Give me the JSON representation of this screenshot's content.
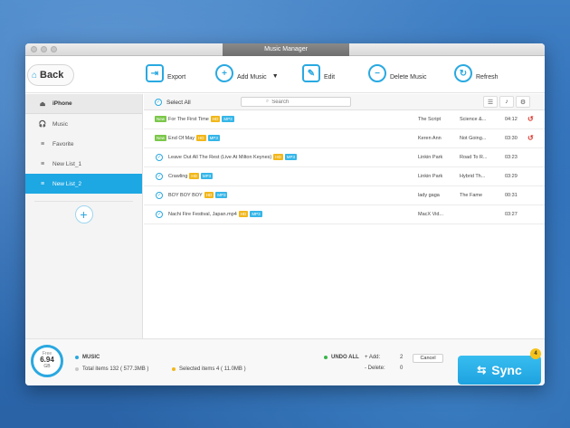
{
  "window": {
    "title": "Music Manager"
  },
  "toolbar": {
    "back_label": "Back",
    "export_label": "Export",
    "add_music_label": "Add Music",
    "edit_label": "Edit",
    "delete_label": "Delete Music",
    "refresh_label": "Refresh"
  },
  "sidebar": {
    "device": "iPhone",
    "items": [
      {
        "label": "Music",
        "icon": "headphones-icon"
      },
      {
        "label": "Favorite",
        "icon": "playlist-icon"
      },
      {
        "label": "New List_1",
        "icon": "playlist-icon"
      },
      {
        "label": "New List_2",
        "icon": "playlist-icon",
        "active": true
      }
    ]
  },
  "list": {
    "select_all_label": "Select All",
    "search_placeholder": "Search",
    "rows": [
      {
        "new": "New",
        "title": "For The First Time",
        "hd": "HD",
        "fmt": "MP3",
        "artist": "The Script",
        "album": "Science &...",
        "time": "04:12",
        "status": "pending"
      },
      {
        "new": "New",
        "title": "End Of May",
        "hd": "HD",
        "fmt": "MP3",
        "artist": "Keren Ann",
        "album": "Not Going...",
        "time": "03:30",
        "status": "pending"
      },
      {
        "new": "",
        "title": "Leave Out All The Rest (Live At Milton Keynes)",
        "hd": "HD",
        "fmt": "MP3",
        "artist": "Linkin Park",
        "album": "Road To R...",
        "time": "03:23",
        "status": "checked"
      },
      {
        "new": "",
        "title": "Crawling",
        "hd": "HD",
        "fmt": "MP3",
        "artist": "Linkin Park",
        "album": "Hybrid Th...",
        "time": "03:29",
        "status": "checked"
      },
      {
        "new": "",
        "title": "BOY BOY BOY",
        "hd": "HD",
        "fmt": "MP3",
        "artist": "lady gaga",
        "album": "The Fame",
        "time": "00:31",
        "status": "checked"
      },
      {
        "new": "",
        "title": "Nachi Fire Festival, Japan.mp4",
        "hd": "HD",
        "fmt": "MP3",
        "artist": "MacX Vid...",
        "album": "",
        "time": "03:27",
        "status": "checked"
      }
    ]
  },
  "footer": {
    "storage_free_label": "Free",
    "storage_value": "6.94",
    "storage_unit": "GB",
    "section_label": "MUSIC",
    "total_items": "Total items 132 ( 577.3MB )",
    "selected_items": "Selected items 4 ( 11.0MB )",
    "undo_all_label": "UNDO ALL",
    "add_label": "+ Add:",
    "add_count": "2",
    "delete_label": "- Delete:",
    "delete_count": "0",
    "cancel_label": "Cancel",
    "sync_label": "Sync",
    "sync_count": "4"
  },
  "colors": {
    "accent": "#1da7e3",
    "new_badge": "#7bc74a",
    "hd_badge": "#f2b71a",
    "undo": "#e0342a"
  }
}
